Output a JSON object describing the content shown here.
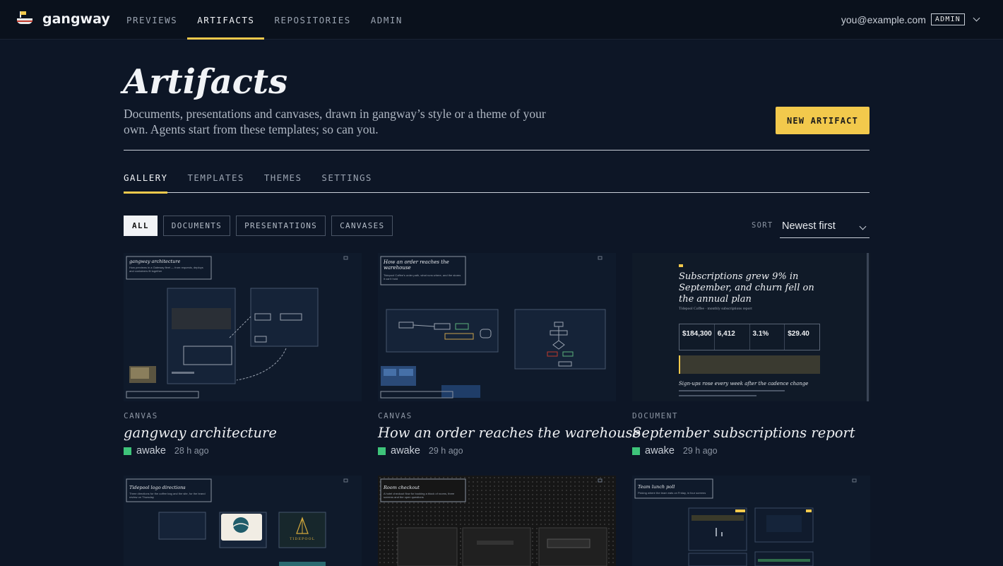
{
  "app": {
    "name": "gangway"
  },
  "nav": {
    "items": [
      {
        "label": "PREVIEWS",
        "active": false
      },
      {
        "label": "ARTIFACTS",
        "active": true
      },
      {
        "label": "REPOSITORIES",
        "active": false
      },
      {
        "label": "ADMIN",
        "active": false
      }
    ]
  },
  "user": {
    "email": "you@example.com",
    "role": "ADMIN"
  },
  "header": {
    "title": "Artifacts",
    "description": "Documents, presentations and canvases, drawn in gangway’s style or a theme of your own. Agents start from these templates; so can you.",
    "new_button": "NEW ARTIFACT"
  },
  "tabs": [
    {
      "label": "GALLERY",
      "active": true
    },
    {
      "label": "TEMPLATES",
      "active": false
    },
    {
      "label": "THEMES",
      "active": false
    },
    {
      "label": "SETTINGS",
      "active": false
    }
  ],
  "filters": [
    {
      "label": "ALL",
      "active": true
    },
    {
      "label": "DOCUMENTS",
      "active": false
    },
    {
      "label": "PRESENTATIONS",
      "active": false
    },
    {
      "label": "CANVASES",
      "active": false
    }
  ],
  "sort": {
    "label": "SORT",
    "value": "Newest first"
  },
  "cards": [
    {
      "type": "CANVAS",
      "title": "gangway architecture",
      "status": "awake",
      "time": "28 h ago",
      "thumb": {
        "heading": "gangway architecture",
        "caption": "How previews in a Gateway fleet — from requests, deploys and containers fit together"
      }
    },
    {
      "type": "CANVAS",
      "title": "How an order reaches the warehouse",
      "status": "awake",
      "time": "29 h ago",
      "thumb": {
        "heading": "How an order reaches the warehouse",
        "caption": "Tidepool Coffee's order path, what runs where, and the stores it can't hold"
      }
    },
    {
      "type": "DOCUMENT",
      "title": "September subscriptions report",
      "status": "awake",
      "time": "29 h ago",
      "thumb": {
        "heading": "Subscriptions grew 9% in September, and churn fell on the annual plan",
        "caption": "Tidepool Coffee · monthly subscriptions report",
        "kpis": [
          "$184,300",
          "6,412",
          "3.1%",
          "$29.40"
        ],
        "subhead": "Sign-ups rose every week after the cadence change"
      }
    },
    {
      "type": "",
      "title": "",
      "status": "",
      "time": "",
      "thumb": {
        "heading": "Tidepool logo directions",
        "caption": "Three directions for the coffee bag and the site, for the brand review on Thursday",
        "logo_word": "TIDEPOOL"
      }
    },
    {
      "type": "",
      "title": "",
      "status": "",
      "time": "",
      "thumb": {
        "heading": "Room checkout",
        "caption": "A hotel checkout flow for booking a block of rooms, three screens and the open questions"
      }
    },
    {
      "type": "",
      "title": "",
      "status": "",
      "time": "",
      "thumb": {
        "heading": "Team lunch poll",
        "caption": "Picking where the team eats on Friday, in four screens"
      }
    }
  ]
}
